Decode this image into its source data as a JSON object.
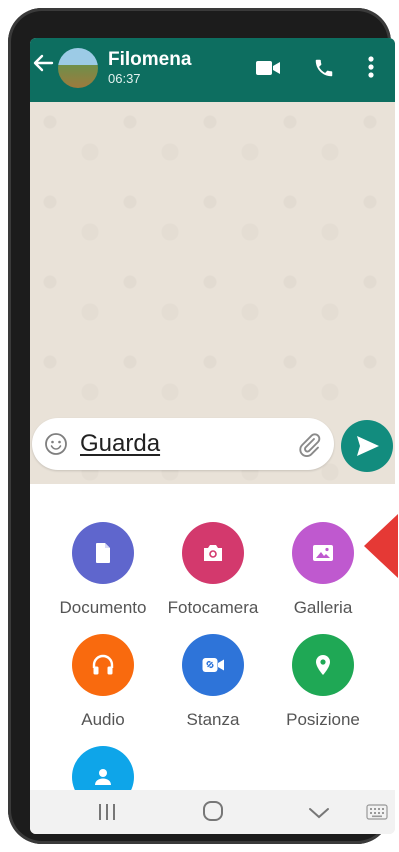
{
  "header": {
    "back_icon": "arrow-left-icon",
    "contact_name": "Filomena",
    "status": "06:37",
    "actions": [
      "video-call-icon",
      "phone-call-icon",
      "more-vert-icon"
    ],
    "color": "#0d6e60"
  },
  "composer": {
    "emoji_icon": "emoji-icon",
    "text": "Guarda",
    "attach_icon": "paperclip-icon",
    "send_icon": "send-icon",
    "send_color": "#128c7e"
  },
  "attachments": {
    "items": [
      {
        "label": "Documento",
        "icon": "document-icon",
        "color": "#5f66cd"
      },
      {
        "label": "Fotocamera",
        "icon": "camera-icon",
        "color": "#d3396d"
      },
      {
        "label": "Galleria",
        "icon": "gallery-icon",
        "color": "#bf59cf"
      },
      {
        "label": "Audio",
        "icon": "headphones-icon",
        "color": "#f96a0e"
      },
      {
        "label": "Stanza",
        "icon": "rooms-icon",
        "color": "#2e74d9"
      },
      {
        "label": "Posizione",
        "icon": "location-icon",
        "color": "#1fa855"
      },
      {
        "label": "",
        "icon": "contact-icon",
        "color": "#0ea5e9"
      }
    ]
  },
  "navbar": {
    "recents_icon": "recents-icon",
    "home_icon": "home-icon",
    "back_icon": "nav-back-icon",
    "keyboard_icon": "keyboard-icon"
  }
}
